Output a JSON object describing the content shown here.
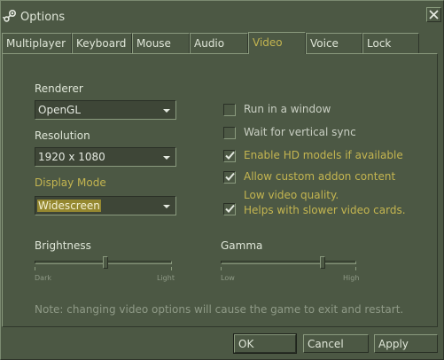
{
  "window": {
    "title": "Options"
  },
  "tabs": [
    {
      "label": "Multiplayer"
    },
    {
      "label": "Keyboard"
    },
    {
      "label": "Mouse"
    },
    {
      "label": "Audio"
    },
    {
      "label": "Video"
    },
    {
      "label": "Voice"
    },
    {
      "label": "Lock"
    }
  ],
  "active_tab": "Video",
  "video": {
    "renderer": {
      "label": "Renderer",
      "value": "OpenGL"
    },
    "resolution": {
      "label": "Resolution",
      "value": "1920 x 1080"
    },
    "display_mode": {
      "label": "Display Mode",
      "value": "Widescreen"
    },
    "options": [
      {
        "label": "Run in a window",
        "checked": false
      },
      {
        "label": "Wait for vertical sync",
        "checked": false
      },
      {
        "label": "Enable HD models if available",
        "checked": true
      },
      {
        "label": "Allow custom addon content",
        "checked": true
      },
      {
        "label": "Low video quality.",
        "label2": "Helps with slower video cards.",
        "checked": true
      }
    ],
    "brightness": {
      "label": "Brightness",
      "min_label": "Dark",
      "max_label": "Light",
      "value": 0.52
    },
    "gamma": {
      "label": "Gamma",
      "min_label": "Low",
      "max_label": "High",
      "value": 0.76
    },
    "note": "Note: changing video options will cause the game to exit and restart."
  },
  "buttons": {
    "ok": "OK",
    "cancel": "Cancel",
    "apply": "Apply"
  },
  "colors": {
    "background": "#4c5844",
    "accent": "#c4b550",
    "highlight": "#958830"
  },
  "icons": {
    "app": "steam-icon",
    "close": "close-icon",
    "dropdown": "chevron-down-icon",
    "check": "check-icon"
  }
}
